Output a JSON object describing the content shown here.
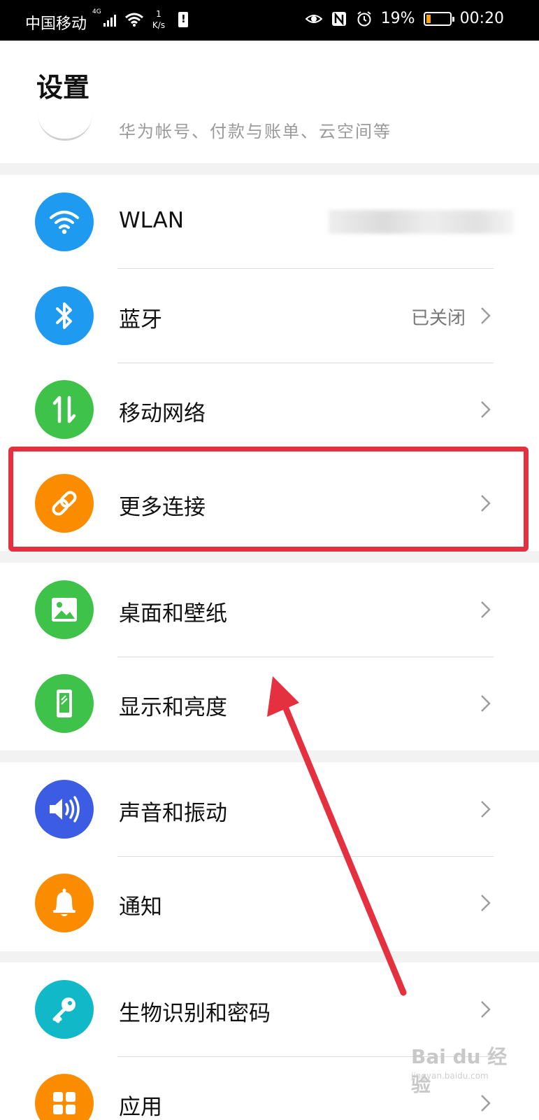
{
  "status_bar": {
    "carrier": "中国移动",
    "network": "4G",
    "speed_value": "1",
    "speed_unit": "K/s",
    "battery": "19%",
    "time": "00:20"
  },
  "header": {
    "title": "设置",
    "account_subtitle": "华为帐号、付款与账单、云空间等"
  },
  "rows": {
    "wlan": {
      "label": "WLAN",
      "icon": "wifi-icon",
      "color": "#1e9af0"
    },
    "bluetooth": {
      "label": "蓝牙",
      "value": "已关闭",
      "icon": "bluetooth-icon",
      "color": "#1e9af0"
    },
    "mobile_network": {
      "label": "移动网络",
      "icon": "mobile-data-icon",
      "color": "#3ec24a"
    },
    "more_connections": {
      "label": "更多连接",
      "icon": "link-icon",
      "color": "#fb8c00"
    },
    "home_wallpaper": {
      "label": "桌面和壁纸",
      "icon": "image-icon",
      "color": "#3ec24a"
    },
    "display_brightness": {
      "label": "显示和亮度",
      "icon": "phone-display-icon",
      "color": "#3ec24a"
    },
    "sound_vibration": {
      "label": "声音和振动",
      "icon": "speaker-icon",
      "color": "#3b5ce3"
    },
    "notifications": {
      "label": "通知",
      "icon": "bell-icon",
      "color": "#fb8c00"
    },
    "biometrics_password": {
      "label": "生物识别和密码",
      "icon": "key-icon",
      "color": "#10b8c8"
    },
    "apps": {
      "label": "应用",
      "icon": "apps-icon",
      "color": "#fb8c00"
    }
  },
  "annotation": {
    "highlight_color": "#e5303f"
  },
  "watermark": {
    "text": "Bai du 经验",
    "sub": "jingyan.baidu.com"
  }
}
